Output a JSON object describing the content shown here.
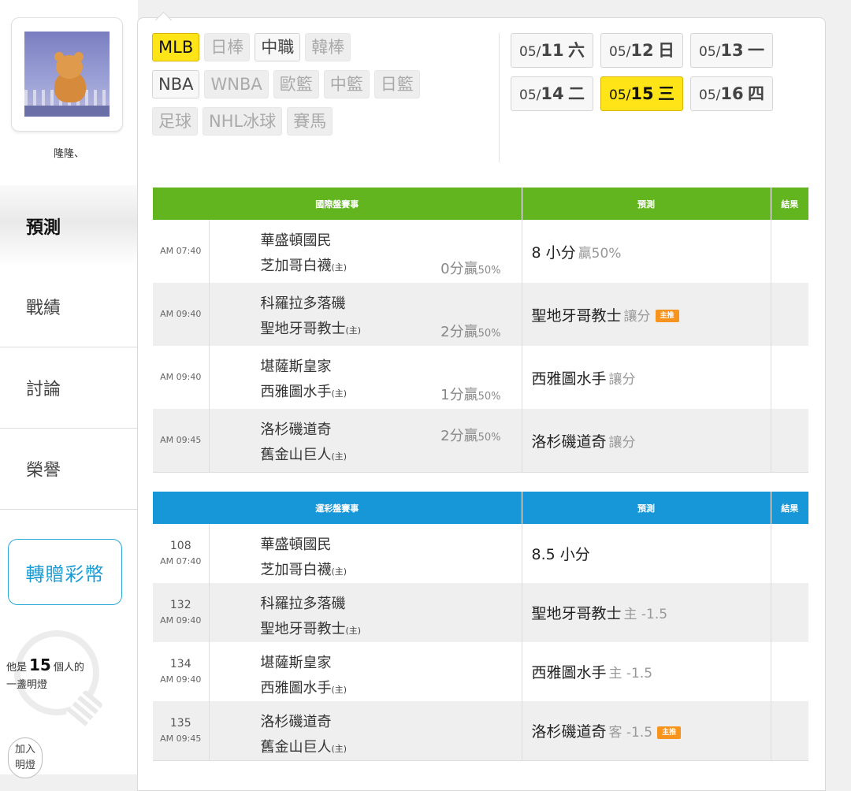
{
  "sidebar": {
    "username": "隆隆、",
    "nav": [
      "預測",
      "戰績",
      "討論",
      "榮譽"
    ],
    "transfer_label": "轉贈彩幣",
    "lamp": {
      "prefix": "他是",
      "count": "15",
      "suffix": "個人的",
      "line2": "一盞明燈"
    },
    "join": {
      "line1": "加入",
      "line2": "明燈"
    }
  },
  "sports": {
    "row1": [
      "MLB",
      "日棒",
      "中職",
      "韓棒"
    ],
    "row2": [
      "NBA",
      "WNBA",
      "歐籃",
      "中籃",
      "日籃"
    ],
    "row3": [
      "足球",
      "NHL冰球",
      "賽馬"
    ]
  },
  "dates": [
    {
      "md": "05/",
      "d": "11",
      "wd": "六"
    },
    {
      "md": "05/",
      "d": "12",
      "wd": "日"
    },
    {
      "md": "05/",
      "d": "13",
      "wd": "一"
    },
    {
      "md": "05/",
      "d": "14",
      "wd": "二"
    },
    {
      "md": "05/",
      "d": "15",
      "wd": "三"
    },
    {
      "md": "05/",
      "d": "16",
      "wd": "四"
    }
  ],
  "intl": {
    "headers": [
      "國際盤賽事",
      "預測",
      "結果"
    ],
    "rows": [
      {
        "time": "AM 07:40",
        "away": "華盛頓國民",
        "home": "芝加哥白襪",
        "home_tag": "(主)",
        "handicap": "0分贏",
        "pct": "50%",
        "pick": "8 小分",
        "pick_sub": "贏50%"
      },
      {
        "time": "AM 09:40",
        "away": "科羅拉多落磯",
        "home": "聖地牙哥教士",
        "home_tag": "(主)",
        "handicap": "2分贏",
        "pct": "50%",
        "pick": "聖地牙哥教士",
        "pick_sub": "讓分",
        "badge": "主推"
      },
      {
        "time": "AM 09:40",
        "away": "堪薩斯皇家",
        "home": "西雅圖水手",
        "home_tag": "(主)",
        "handicap": "1分贏",
        "pct": "50%",
        "pick": "西雅圖水手",
        "pick_sub": "讓分"
      },
      {
        "time": "AM 09:45",
        "away": "洛杉磯道奇",
        "home": "舊金山巨人",
        "home_tag": "(主)",
        "handicap": "2分贏",
        "pct": "50%",
        "pick": "洛杉磯道奇",
        "pick_sub": "讓分"
      }
    ]
  },
  "sport_lottery": {
    "headers": [
      "運彩盤賽事",
      "預測",
      "結果"
    ],
    "rows": [
      {
        "no": "108",
        "time": "AM 07:40",
        "away": "華盛頓國民",
        "home": "芝加哥白襪",
        "home_tag": "(主)",
        "pick": "8.5 小分",
        "pick_sub": ""
      },
      {
        "no": "132",
        "time": "AM 09:40",
        "away": "科羅拉多落磯",
        "home": "聖地牙哥教士",
        "home_tag": "(主)",
        "pick": "聖地牙哥教士",
        "pick_sub": "主 -1.5"
      },
      {
        "no": "134",
        "time": "AM 09:40",
        "away": "堪薩斯皇家",
        "home": "西雅圖水手",
        "home_tag": "(主)",
        "pick": "西雅圖水手",
        "pick_sub": "主 -1.5"
      },
      {
        "no": "135",
        "time": "AM 09:45",
        "away": "洛杉磯道奇",
        "home": "舊金山巨人",
        "home_tag": "(主)",
        "pick": "洛杉磯道奇",
        "pick_sub": "客 -1.5",
        "badge": "主推"
      }
    ]
  }
}
